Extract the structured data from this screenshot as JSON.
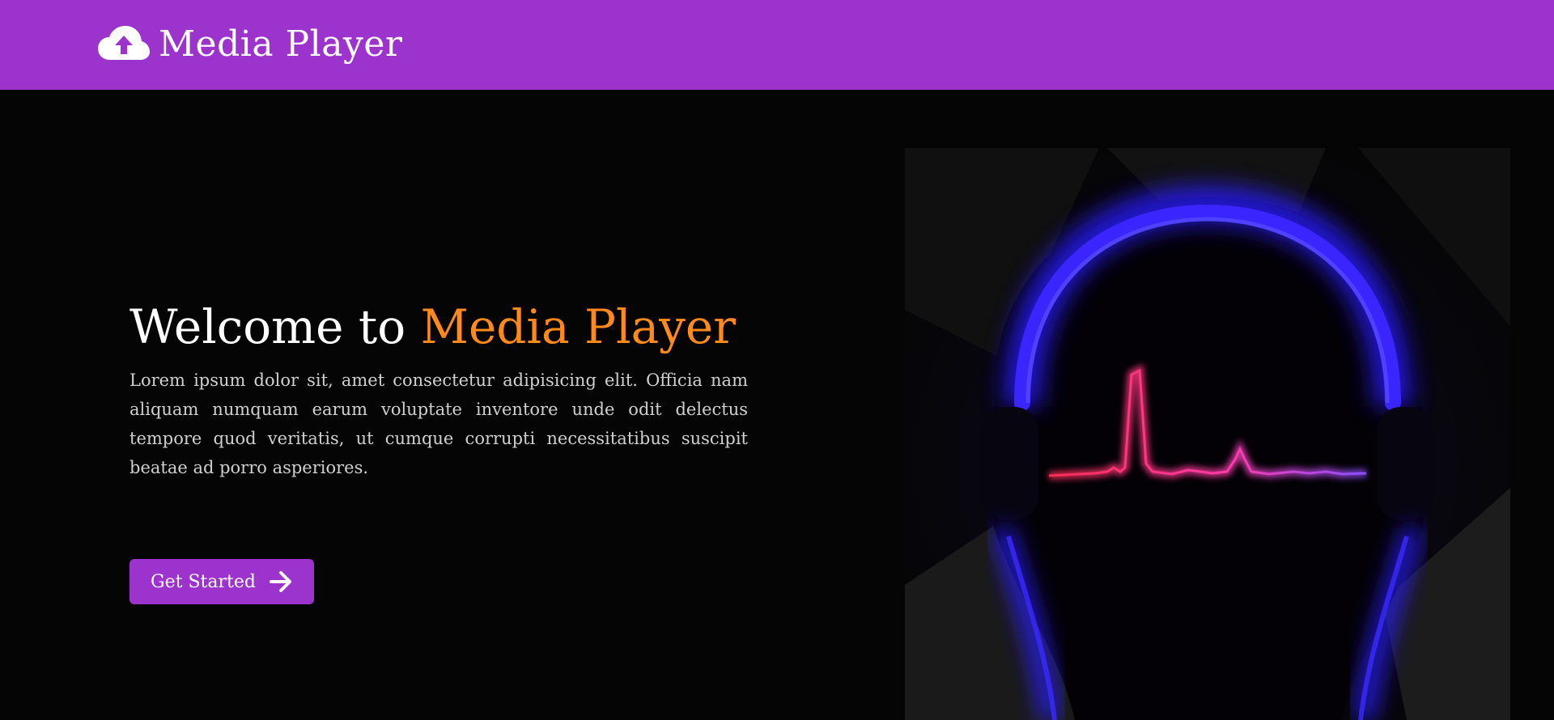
{
  "navbar": {
    "brand_icon": "cloud-upload-icon",
    "brand_name": "Media Player"
  },
  "hero": {
    "title_prefix": "Welcome to ",
    "title_accent": "Media Player",
    "description": "Lorem ipsum dolor sit, amet consectetur adipisicing elit. Officia nam aliquam numquam earum voluptate inventore unde odit delectus tempore quod veritatis, ut cumque corrupti necessitatibus suscipit beatae ad porro asperiores.",
    "cta_label": "Get Started",
    "cta_icon": "arrow-right-icon",
    "image": "headphones-pulse-image"
  },
  "colors": {
    "brand": "#9c33cc",
    "accent": "#ff8a1a",
    "background": "#050505",
    "text": "#ffffff",
    "muted_text": "#cfcfcf"
  }
}
